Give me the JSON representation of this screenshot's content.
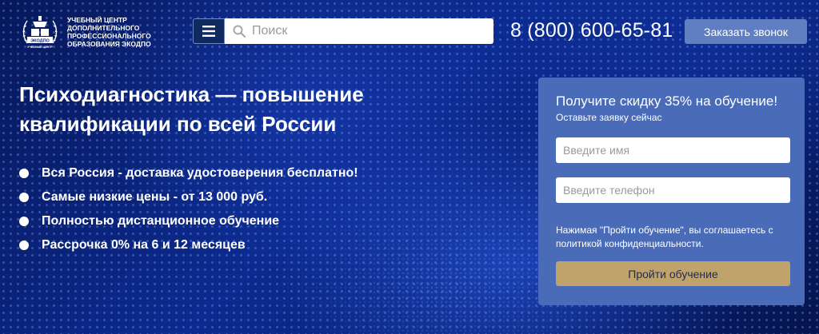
{
  "header": {
    "logo": {
      "emblem_top": "ЭКОДПО",
      "emblem_bottom": "УЧЕБНЫЙ ЦЕНТР",
      "text": "УЧЕБНЫЙ ЦЕНТР ДОПОЛНИТЕЛЬНОГО ПРОФЕССИОНАЛЬНОГО ОБРАЗОВАНИЯ ЭКОДПО"
    },
    "menu_icon": "hamburger-icon",
    "search": {
      "icon": "search-icon",
      "placeholder": "Поиск",
      "value": ""
    },
    "phone": "8 (800) 600-65-81",
    "callback_label": "Заказать звонок"
  },
  "hero": {
    "title": "Психодиагностика — повышение квалификации по всей России",
    "benefits": [
      "Вся Россия - доставка удостоверения бесплатно!",
      "Самые низкие цены - от 13 000 руб.",
      "Полностью дистанционное обучение",
      "Рассрочка 0% на 6 и 12 месяцев"
    ]
  },
  "form": {
    "title": "Получите скидку 35% на обучение!",
    "subtitle": "Оставьте заявку сейчас",
    "name_placeholder": "Введите имя",
    "name_value": "",
    "phone_placeholder": "Введите телефон",
    "phone_value": "",
    "consent": "Нажимая \"Пройти обучение\", вы соглашаетесь с политикой конфиденциальности.",
    "submit_label": "Пройти обучение"
  },
  "colors": {
    "background": "#0a1f6e",
    "form_panel": "#4a6cb8",
    "callback_button": "#5f7fc2",
    "submit_button": "#bfa36a",
    "menu_button": "#0f2a5e"
  }
}
